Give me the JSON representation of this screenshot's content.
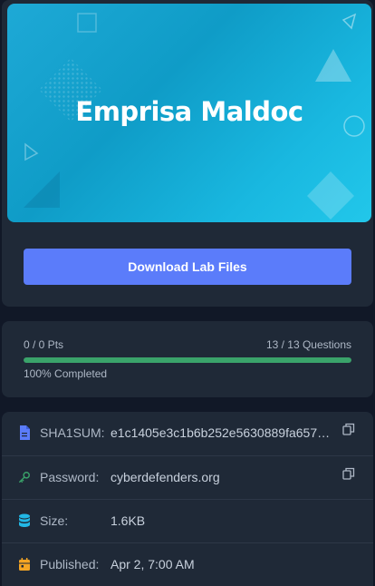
{
  "banner": {
    "title": "Emprisa Maldoc"
  },
  "download_button": {
    "label": "Download Lab Files"
  },
  "progress": {
    "points_text": "0 / 0 Pts",
    "questions_text": "13 / 13 Questions",
    "completed_text": "100% Completed",
    "percent": 100,
    "color": "#3aa36a"
  },
  "info": {
    "sha1": {
      "label": "SHA1SUM:",
      "value": "e1c1405e3c1b6b252e5630889fa657…",
      "icon": "file-icon",
      "icon_color": "#5b7cfa"
    },
    "password": {
      "label": "Password:",
      "value": "cyberdefenders.org",
      "icon": "key-icon",
      "icon_color": "#3aa36a"
    },
    "size": {
      "label": "Size:",
      "value": "1.6KB",
      "icon": "database-icon",
      "icon_color": "#22b8e6"
    },
    "published": {
      "label": "Published:",
      "value": "Apr 2, 7:00 AM",
      "icon": "calendar-icon",
      "icon_color": "#f5a524"
    }
  }
}
